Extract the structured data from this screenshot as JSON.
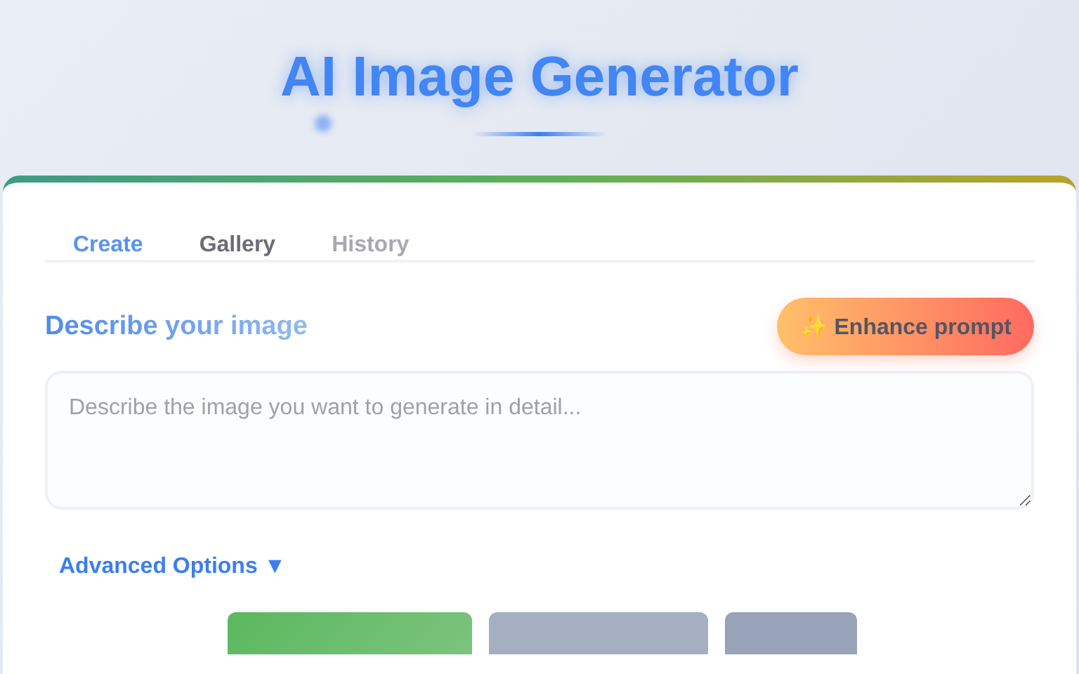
{
  "header": {
    "title": "AI Image Generator"
  },
  "tabs": [
    {
      "label": "Create",
      "selected": true,
      "disabled": false
    },
    {
      "label": "Gallery",
      "selected": false,
      "disabled": false
    },
    {
      "label": "History",
      "selected": false,
      "disabled": true
    }
  ],
  "prompt": {
    "label": "Describe your image",
    "enhance_button": "✨ Enhance prompt",
    "placeholder": "Describe the image you want to generate in detail..."
  },
  "advanced_options": {
    "label": "Advanced Options ▼",
    "expanded": false
  },
  "action_buttons": [
    {
      "kind": "primary"
    },
    {
      "kind": "secondary"
    },
    {
      "kind": "secondary"
    }
  ]
}
